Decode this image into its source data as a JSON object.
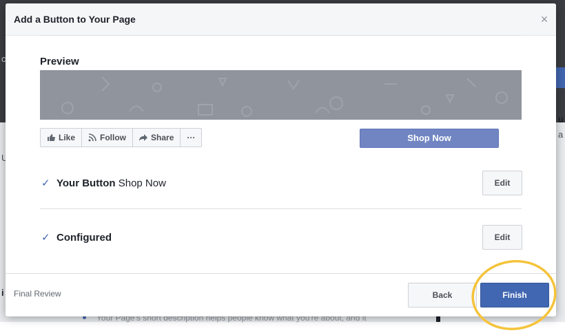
{
  "background": {
    "side_fragments": [
      "c",
      "U",
      "i",
      "u",
      "a"
    ],
    "bottom_text": "Your Page's short description helps people know what you're about, and it"
  },
  "dialog": {
    "title": "Add a Button to Your Page",
    "close_glyph": "×",
    "preview": {
      "label": "Preview",
      "actions": [
        {
          "label": "Like",
          "icon": "thumbs-up-icon"
        },
        {
          "label": "Follow",
          "icon": "rss-icon"
        },
        {
          "label": "Share",
          "icon": "share-arrow-icon"
        },
        {
          "label": "···",
          "icon": "more-icon"
        }
      ],
      "cta_label": "Shop Now"
    },
    "steps": [
      {
        "title": "Your Button",
        "value": "Shop Now",
        "edit_label": "Edit",
        "status": "done"
      },
      {
        "title": "Configured",
        "value": "",
        "edit_label": "Edit",
        "status": "done"
      }
    ],
    "footer": {
      "step_label": "Final Review",
      "back_label": "Back",
      "finish_label": "Finish"
    }
  },
  "colors": {
    "accent": "#4267b2",
    "cta": "#7085c2",
    "cover": "#90949c",
    "highlight": "#f5c33b"
  }
}
